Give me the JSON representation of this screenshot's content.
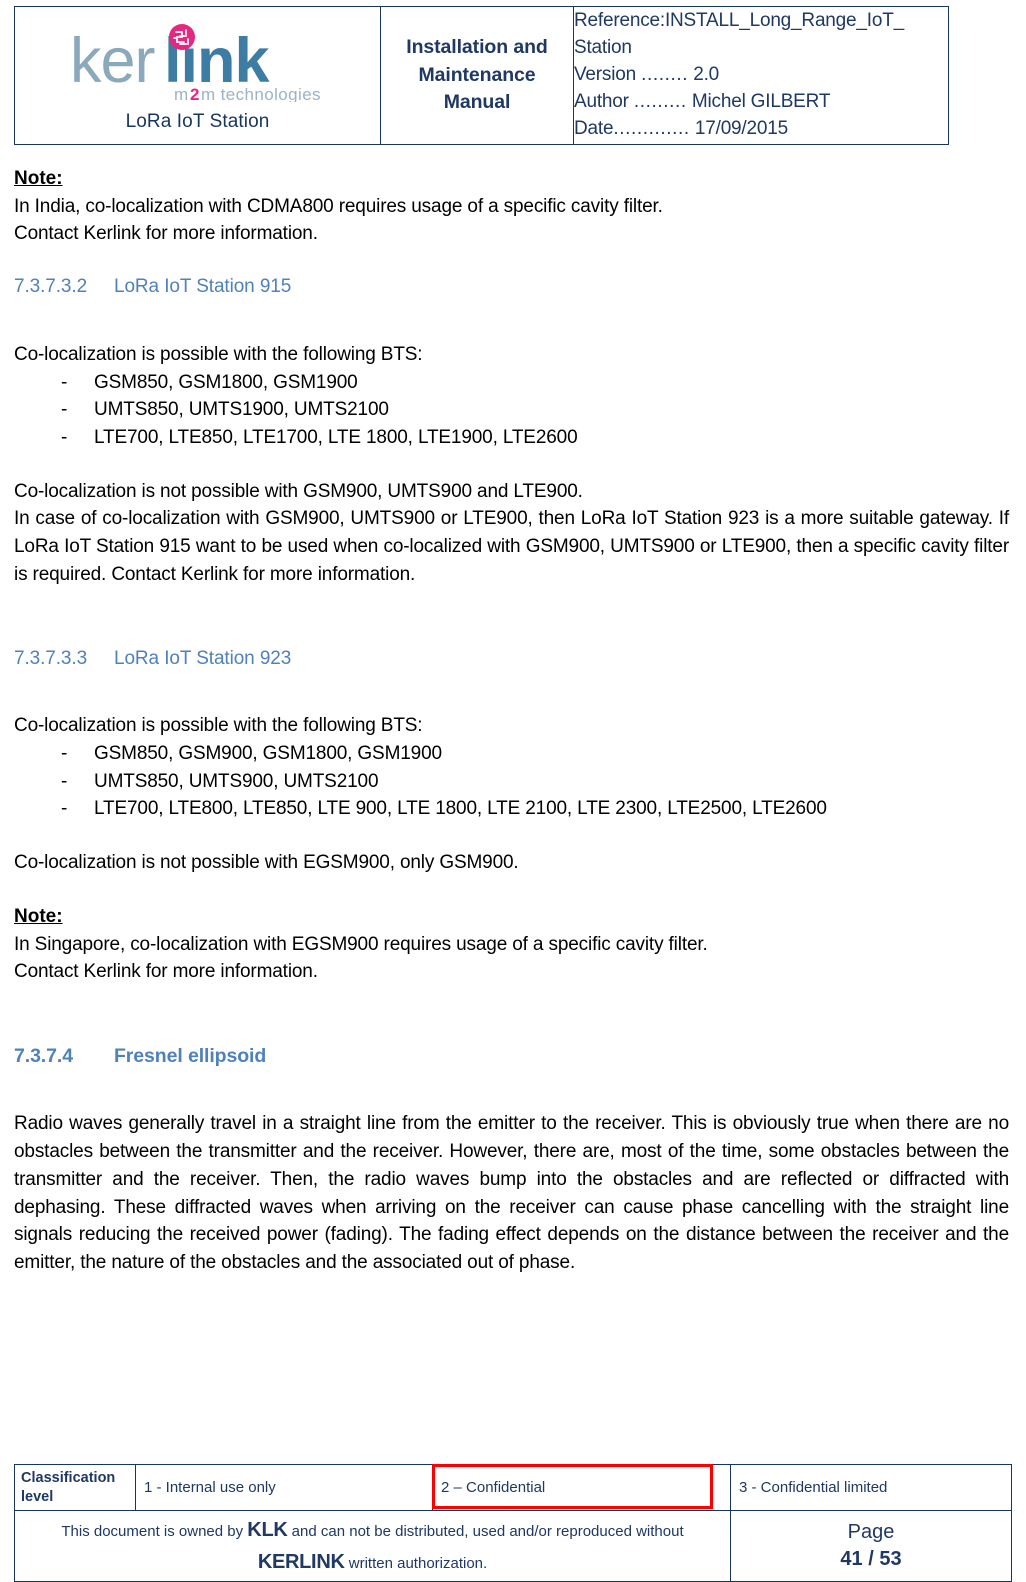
{
  "header": {
    "logo": {
      "brand_part1": "ker",
      "brand_part2": "link",
      "tagline_part1": "m",
      "tagline_part2": "2",
      "tagline_part3": "m technologies",
      "product": "LoRa IoT Station"
    },
    "doc_title": "Installation and Maintenance Manual",
    "doc_title_lines": [
      "Installation and",
      "Maintenance",
      "Manual"
    ],
    "meta": {
      "reference_label": "Reference:",
      "reference_value": "INSTALL_Long_Range_IoT_Station",
      "reference_line1": "Reference:INSTALL_Long_Range_IoT_",
      "reference_line2": "Station",
      "version_label": "Version",
      "version_dots": "........",
      "version_value": "2.0",
      "author_label": "Author",
      "author_dots": ".........",
      "author_value": "Michel GILBERT",
      "date_label": "Date",
      "date_dots": ".............",
      "date_value": "17/09/2015"
    }
  },
  "content": {
    "note1": {
      "label": "Note:",
      "line1": "In India, co-localization with CDMA800 requires usage of a specific cavity filter.",
      "line2": "Contact Kerlink for more information."
    },
    "section_915": {
      "number": "7.3.7.3.2",
      "title": "LoRa IoT Station 915",
      "intro": "Co-localization is possible with the following BTS:",
      "bullets": [
        "GSM850, GSM1800, GSM1900",
        "UMTS850, UMTS1900, UMTS2100",
        "LTE700, LTE850, LTE1700, LTE 1800, LTE1900, LTE2600"
      ],
      "para1": "Co-localization is not possible with GSM900, UMTS900 and LTE900.",
      "para2": "In case of co-localization with GSM900, UMTS900 or LTE900, then LoRa IoT Station 923 is a more suitable gateway. If LoRa IoT Station 915 want to be used when co-localized with GSM900, UMTS900 or LTE900, then a specific cavity filter is required. Contact Kerlink for more information."
    },
    "section_923": {
      "number": "7.3.7.3.3",
      "title": "LoRa IoT Station 923",
      "intro": "Co-localization is possible with the following BTS:",
      "bullets": [
        "GSM850, GSM900, GSM1800, GSM1900",
        "UMTS850, UMTS900, UMTS2100",
        "LTE700, LTE800, LTE850, LTE 900, LTE 1800, LTE 2100, LTE 2300, LTE2500, LTE2600"
      ],
      "para1": "Co-localization is not possible with EGSM900, only GSM900."
    },
    "note2": {
      "label": "Note:",
      "line1": "In Singapore, co-localization with EGSM900 requires usage of a specific cavity filter.",
      "line2": "Contact Kerlink for more information."
    },
    "section_fresnel": {
      "number": "7.3.7.4",
      "title": "Fresnel ellipsoid",
      "para1": "Radio waves generally travel in a straight line from the emitter to the receiver. This is obviously true when there are no obstacles between the transmitter and the receiver. However, there are, most of the time, some obstacles between the transmitter and the receiver. Then, the radio waves bump into the obstacles and are reflected or diffracted with dephasing. These diffracted waves when arriving on the receiver can cause phase cancelling with the straight line signals reducing the received power (fading). The fading effect depends on the distance between the receiver and the emitter, the nature of the obstacles and the associated out of phase."
    }
  },
  "footer": {
    "classification_label": "Classification level",
    "classification_options": [
      "1 - Internal use only",
      "2 – Confidential",
      "3 - Confidential limited"
    ],
    "selected_classification_index": 1,
    "highlight_color": "#ff0000",
    "ownership_part1": "This document is owned by ",
    "ownership_klk": "KLK",
    "ownership_part2": " and can not be distributed, used and/or reproduced  without ",
    "ownership_kerlink": "KERLINK",
    "ownership_part3": " written authorization.",
    "page_label": "Page",
    "page_number": "41 / 53"
  },
  "colors": {
    "heading_blue": "#4f81bd",
    "navy": "#1f3864",
    "logo_light": "#8aa9bd",
    "logo_dark": "#3d7ca3",
    "logo_pink": "#e5277f",
    "red": "#ff0000"
  }
}
